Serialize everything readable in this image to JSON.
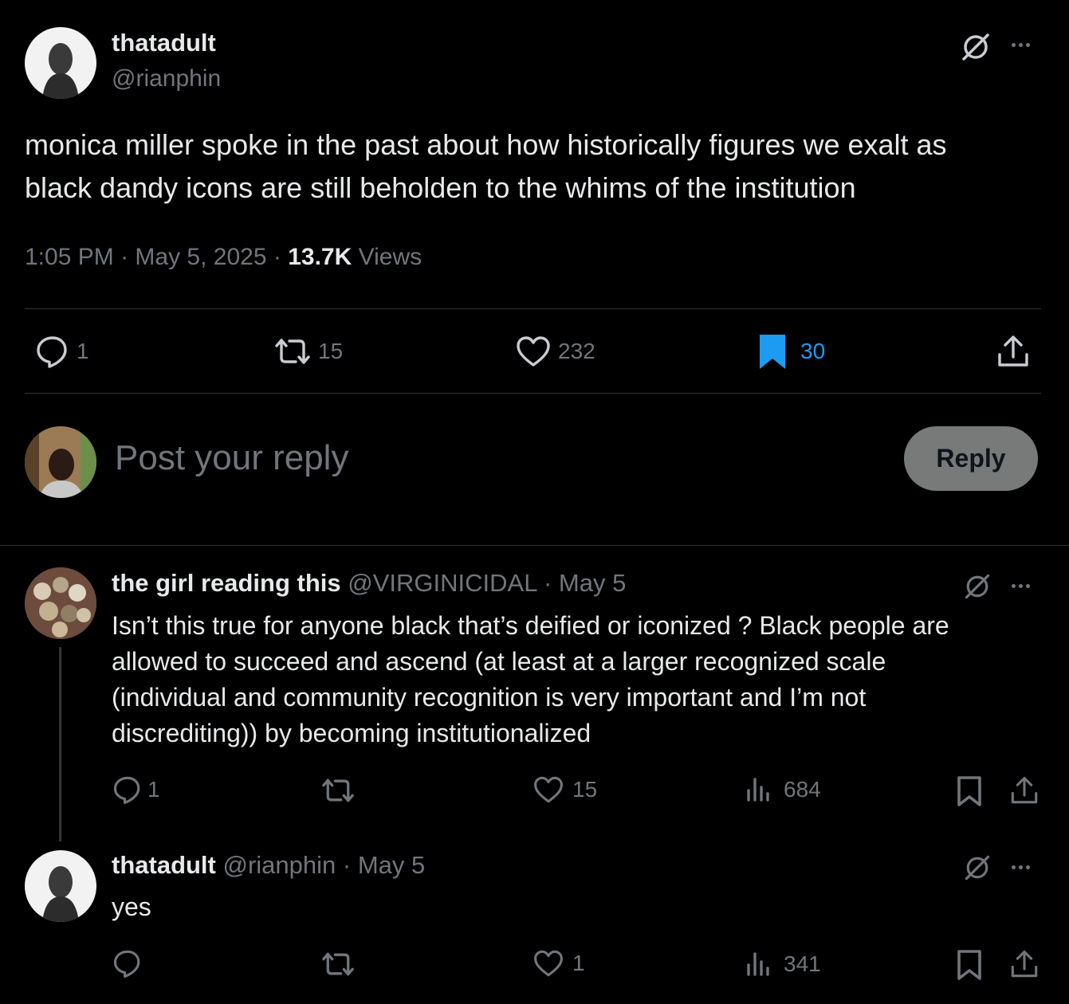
{
  "main_post": {
    "display_name": "thatadult",
    "handle": "@rianphin",
    "text_line1": "monica miller spoke in the past about how historically figures we exalt as",
    "text_line2": "black dandy icons are still beholden to the whims of the institution",
    "time": "1:05 PM",
    "date": "May 5, 2025",
    "views_count": "13.7K",
    "views_label": "Views",
    "sep": "·",
    "stats": {
      "replies": "1",
      "reposts": "15",
      "likes": "232",
      "bookmarks": "30"
    }
  },
  "composer": {
    "placeholder": "Post your reply",
    "button_label": "Reply"
  },
  "replies": [
    {
      "display_name": "the girl reading this",
      "handle": "@VIRGINICIDAL",
      "date": "May 5",
      "sep": "·",
      "text_lines": [
        "Isn’t this true for anyone black that’s deified or iconized ? Black people are",
        "allowed to succeed and ascend (at least at a larger recognized scale",
        "(individual and community recognition is very important and I’m not",
        "discrediting)) by becoming institutionalized"
      ],
      "stats": {
        "replies": "1",
        "reposts": "",
        "likes": "15",
        "views": "684"
      }
    },
    {
      "display_name": "thatadult",
      "handle": "@rianphin",
      "date": "May 5",
      "sep": "·",
      "text_lines": [
        "yes"
      ],
      "stats": {
        "replies": "",
        "reposts": "",
        "likes": "1",
        "views": "341"
      }
    }
  ],
  "colors": {
    "background": "#000000",
    "text": "#e7e9ea",
    "muted": "#71767b",
    "accent": "#1d9bf0",
    "divider": "#2f3336",
    "reply_button": "#787a7a"
  },
  "icons": [
    "grok-icon",
    "more-icon",
    "reply-icon",
    "repost-icon",
    "like-icon",
    "bookmark-icon",
    "share-icon",
    "views-icon"
  ]
}
